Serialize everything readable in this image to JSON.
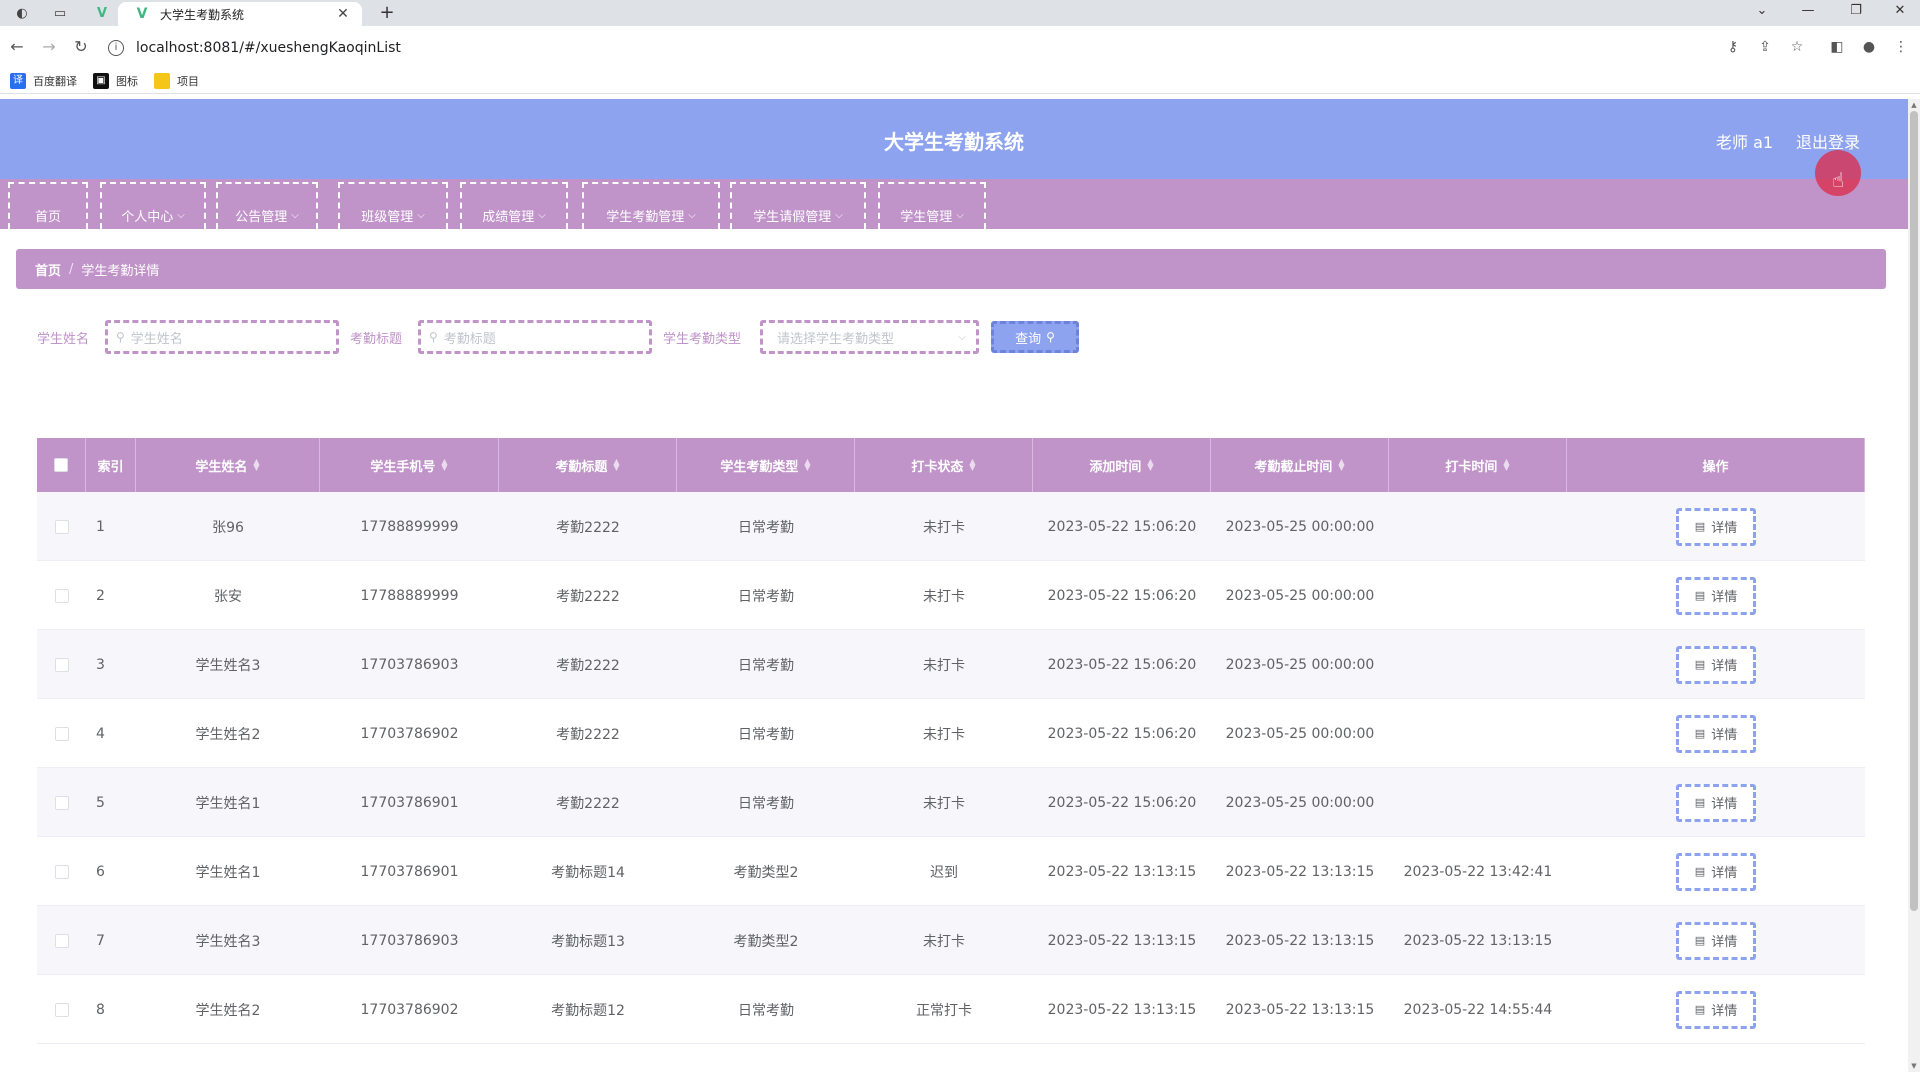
{
  "browser": {
    "tab_title": "大学生考勤系统",
    "url": "localhost:8081/#/xueshengKaoqinList",
    "bookmarks": [
      {
        "label": "百度翻译",
        "color": "#2a6ff0"
      },
      {
        "label": "图标",
        "color": "#111111"
      },
      {
        "label": "项目",
        "color": "#f5c518"
      }
    ]
  },
  "header": {
    "title": "大学生考勤系统",
    "user": "老师 a1",
    "logout": "退出登录"
  },
  "nav": [
    {
      "label": "首页",
      "has_dropdown": false
    },
    {
      "label": "个人中心",
      "has_dropdown": true
    },
    {
      "label": "公告管理",
      "has_dropdown": true
    },
    {
      "label": "班级管理",
      "has_dropdown": true
    },
    {
      "label": "成绩管理",
      "has_dropdown": true
    },
    {
      "label": "学生考勤管理",
      "has_dropdown": true
    },
    {
      "label": "学生请假管理",
      "has_dropdown": true
    },
    {
      "label": "学生管理",
      "has_dropdown": true
    }
  ],
  "breadcrumb": {
    "home": "首页",
    "current": "学生考勤详情"
  },
  "search": {
    "name_label": "学生姓名",
    "name_placeholder": "学生姓名",
    "title_label": "考勤标题",
    "title_placeholder": "考勤标题",
    "type_label": "学生考勤类型",
    "type_placeholder": "请选择学生考勤类型",
    "query_label": "查询"
  },
  "table": {
    "columns": [
      "索引",
      "学生姓名",
      "学生手机号",
      "考勤标题",
      "学生考勤类型",
      "打卡状态",
      "添加时间",
      "考勤截止时间",
      "打卡时间",
      "操作"
    ],
    "detail_label": "详情",
    "rows": [
      {
        "index": "1",
        "name": "张96",
        "phone": "17788899999",
        "title": "考勤2222",
        "type": "日常考勤",
        "status": "未打卡",
        "added": "2023-05-22 15:06:20",
        "deadline": "2023-05-25 00:00:00",
        "punch": ""
      },
      {
        "index": "2",
        "name": "张安",
        "phone": "17788889999",
        "title": "考勤2222",
        "type": "日常考勤",
        "status": "未打卡",
        "added": "2023-05-22 15:06:20",
        "deadline": "2023-05-25 00:00:00",
        "punch": ""
      },
      {
        "index": "3",
        "name": "学生姓名3",
        "phone": "17703786903",
        "title": "考勤2222",
        "type": "日常考勤",
        "status": "未打卡",
        "added": "2023-05-22 15:06:20",
        "deadline": "2023-05-25 00:00:00",
        "punch": ""
      },
      {
        "index": "4",
        "name": "学生姓名2",
        "phone": "17703786902",
        "title": "考勤2222",
        "type": "日常考勤",
        "status": "未打卡",
        "added": "2023-05-22 15:06:20",
        "deadline": "2023-05-25 00:00:00",
        "punch": ""
      },
      {
        "index": "5",
        "name": "学生姓名1",
        "phone": "17703786901",
        "title": "考勤2222",
        "type": "日常考勤",
        "status": "未打卡",
        "added": "2023-05-22 15:06:20",
        "deadline": "2023-05-25 00:00:00",
        "punch": ""
      },
      {
        "index": "6",
        "name": "学生姓名1",
        "phone": "17703786901",
        "title": "考勤标题14",
        "type": "考勤类型2",
        "status": "迟到",
        "added": "2023-05-22 13:13:15",
        "deadline": "2023-05-22 13:13:15",
        "punch": "2023-05-22 13:42:41"
      },
      {
        "index": "7",
        "name": "学生姓名3",
        "phone": "17703786903",
        "title": "考勤标题13",
        "type": "考勤类型2",
        "status": "未打卡",
        "added": "2023-05-22 13:13:15",
        "deadline": "2023-05-22 13:13:15",
        "punch": "2023-05-22 13:13:15"
      },
      {
        "index": "8",
        "name": "学生姓名2",
        "phone": "17703786902",
        "title": "考勤标题12",
        "type": "日常考勤",
        "status": "正常打卡",
        "added": "2023-05-22 13:13:15",
        "deadline": "2023-05-22 13:13:15",
        "punch": "2023-05-22 14:55:44"
      }
    ]
  }
}
